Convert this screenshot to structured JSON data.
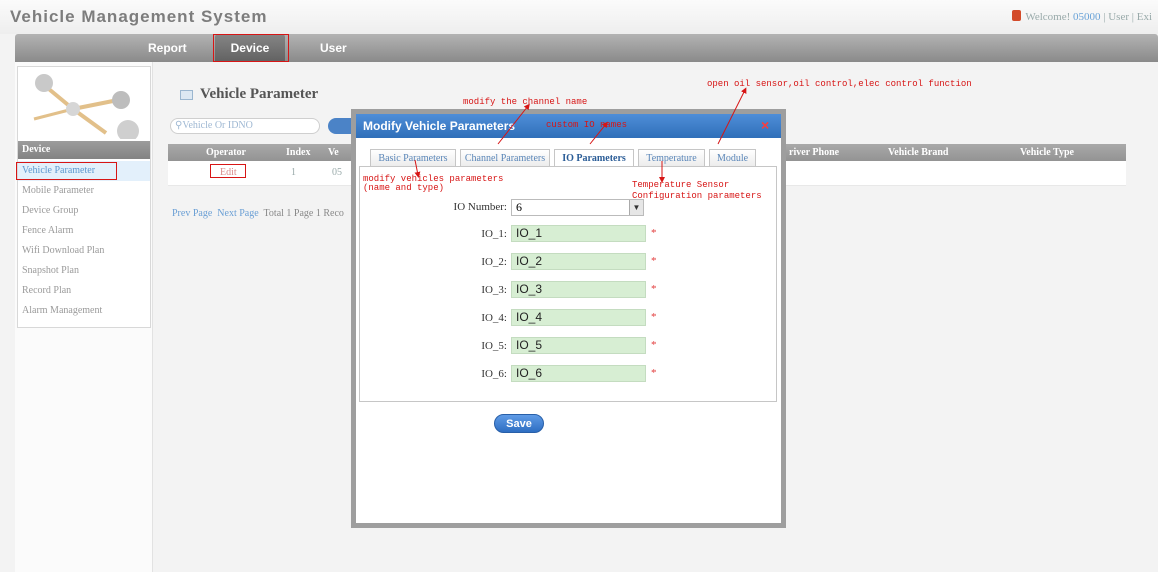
{
  "app": {
    "title": "Vehicle Management System",
    "welcome": "Welcome!",
    "user_name": "05000",
    "user_role": "| User |",
    "exit": "Exi"
  },
  "nav": {
    "items": [
      "Report",
      "Device",
      "User"
    ],
    "active": "Device"
  },
  "sidebar": {
    "header": "Device",
    "items": [
      "Vehicle Parameter",
      "Mobile Parameter",
      "Device Group",
      "Fence Alarm",
      "Wifi Download Plan",
      "Snapshot Plan",
      "Record Plan",
      "Alarm Management"
    ],
    "active": "Vehicle Parameter"
  },
  "main": {
    "title": "Vehicle Parameter",
    "search_placeholder": "Vehicle Or IDNO",
    "table_headers": [
      "Operator",
      "Index",
      "Ve",
      "river Phone",
      "Vehicle Brand",
      "Vehicle Type"
    ],
    "row": {
      "operator": "Edit",
      "index": "1",
      "vehicle": "05"
    },
    "pager": {
      "prev": "Prev Page",
      "next": "Next Page",
      "summary": "Total 1 Page  1 Reco"
    }
  },
  "modal": {
    "title": "Modify Vehicle Parameters",
    "close": "×",
    "tabs": [
      "Basic Parameters",
      "Channel Parameters",
      "IO Parameters",
      "Temperature",
      "Module"
    ],
    "active_tab": "IO Parameters",
    "io_number_label": "IO Number:",
    "io_number_value": "6",
    "io_fields": [
      {
        "label": "IO_1:",
        "value": "IO_1"
      },
      {
        "label": "IO_2:",
        "value": "IO_2"
      },
      {
        "label": "IO_3:",
        "value": "IO_3"
      },
      {
        "label": "IO_4:",
        "value": "IO_4"
      },
      {
        "label": "IO_5:",
        "value": "IO_5"
      },
      {
        "label": "IO_6:",
        "value": "IO_6"
      }
    ],
    "required_mark": "*",
    "save_label": "Save"
  },
  "annotations": {
    "channel": "modify the channel name",
    "io_names": "custom IO names",
    "module": "open oil sensor,oil control,elec control function",
    "basic_1": "modify vehicles parameters",
    "basic_2": "(name and type)",
    "temp_1": "Temperature Sensor",
    "temp_2": "Configuration parameters"
  },
  "colors": {
    "accent": "#2f6fb9",
    "annotation": "#d71515",
    "input_bg": "#d7eed3"
  }
}
